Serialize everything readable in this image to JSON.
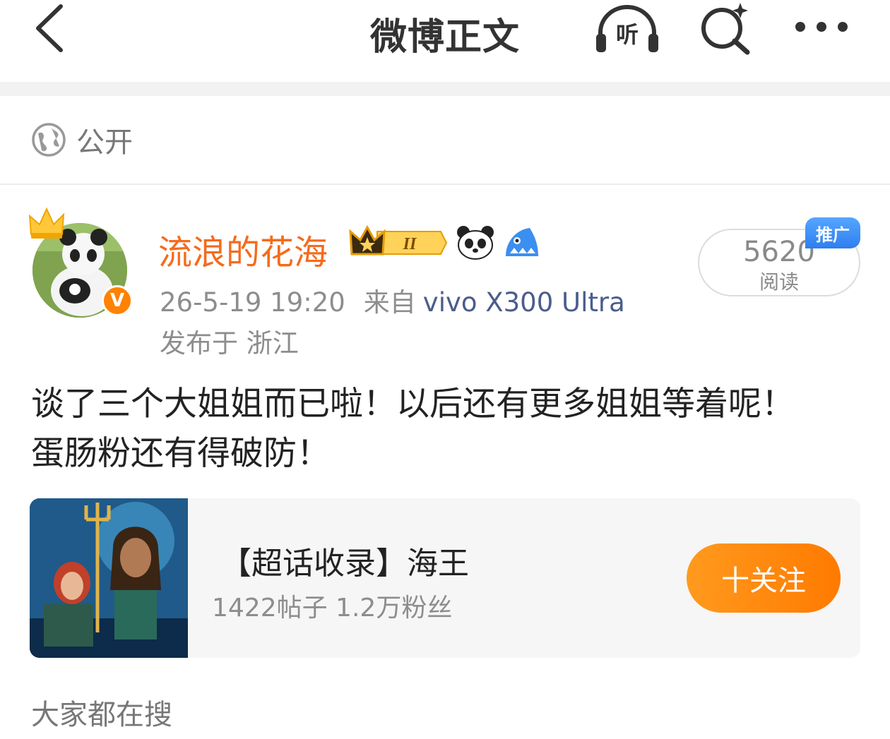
{
  "header": {
    "title": "微博正文",
    "listen_label": "听"
  },
  "visibility": {
    "label": "公开"
  },
  "author": {
    "name": "流浪的花海",
    "verified_badge": "V",
    "level_badge": "II"
  },
  "post": {
    "timestamp": "26-5-19 19:20",
    "from_label": "来自",
    "device": "vivo X300 Ultra",
    "location": "发布于 浙江",
    "text_line1": "谈了三个大姐姐而已啦！以后还有更多姐姐等着呢！",
    "text_line2": "蛋肠粉还有得破防！"
  },
  "read_stats": {
    "count": "5620",
    "label": "阅读",
    "promo_tag": "推广"
  },
  "supertopic": {
    "title": "【超话收录】海王",
    "stats": "1422帖子 1.2万粉丝",
    "follow_label": "十关注"
  },
  "section": {
    "title": "大家都在搜"
  },
  "colors": {
    "brand_orange": "#ff8200",
    "author_name": "#f56b1c",
    "device_link": "#4a5d8c",
    "promo_blue": "#2e7ef0"
  },
  "icons": [
    "back-arrow-icon",
    "listen-headphone-icon",
    "ai-search-icon",
    "more-dots-icon",
    "globe-icon",
    "crown-icon",
    "panda-icon",
    "shark-icon"
  ]
}
